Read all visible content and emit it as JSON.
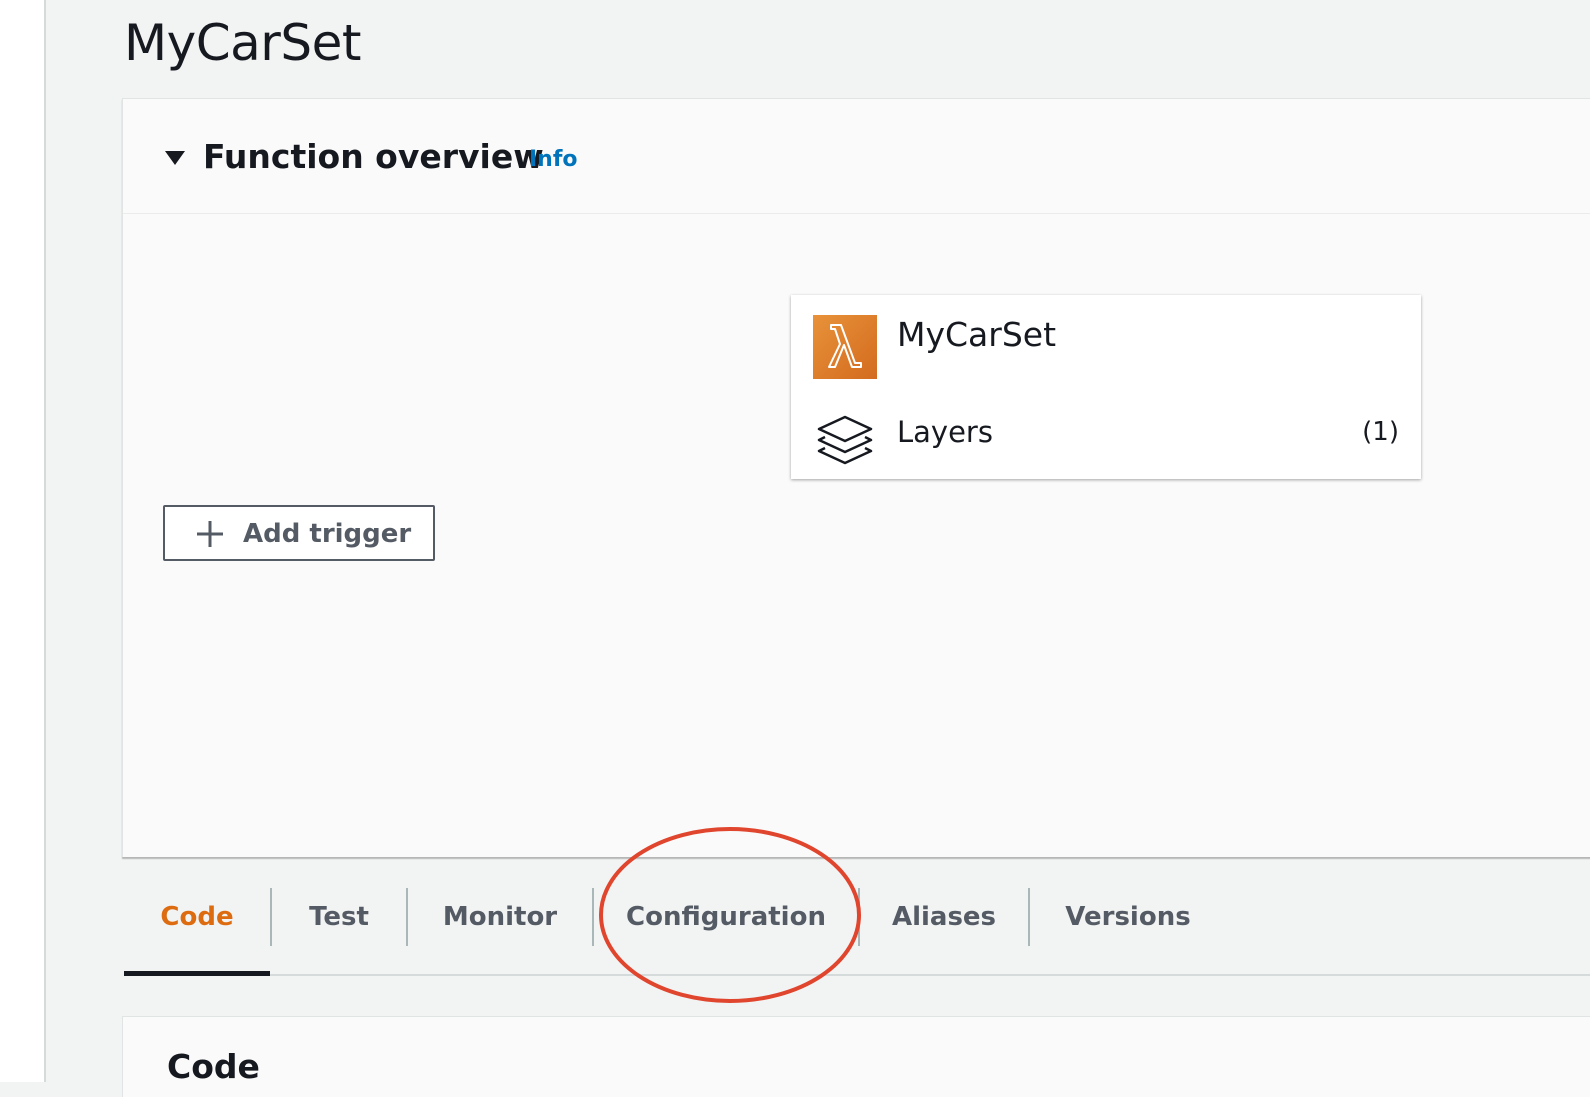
{
  "page": {
    "title": "MyCarSet"
  },
  "overview": {
    "title": "Function overview",
    "info_link": "Info",
    "card": {
      "function_name": "MyCarSet",
      "layers_label": "Layers",
      "layers_count": "(1)"
    },
    "add_trigger_label": "Add trigger"
  },
  "tabs": [
    {
      "label": "Code",
      "active": true
    },
    {
      "label": "Test",
      "active": false
    },
    {
      "label": "Monitor",
      "active": false
    },
    {
      "label": "Configuration",
      "active": false
    },
    {
      "label": "Aliases",
      "active": false
    },
    {
      "label": "Versions",
      "active": false
    }
  ],
  "code_panel": {
    "title": "Code"
  },
  "annotation": {
    "highlighted_tab": "Configuration",
    "color": "#e0452e"
  },
  "colors": {
    "accent_orange": "#dd6b10",
    "link_blue": "#0073bb",
    "lambda_orange": "#e8923a"
  }
}
